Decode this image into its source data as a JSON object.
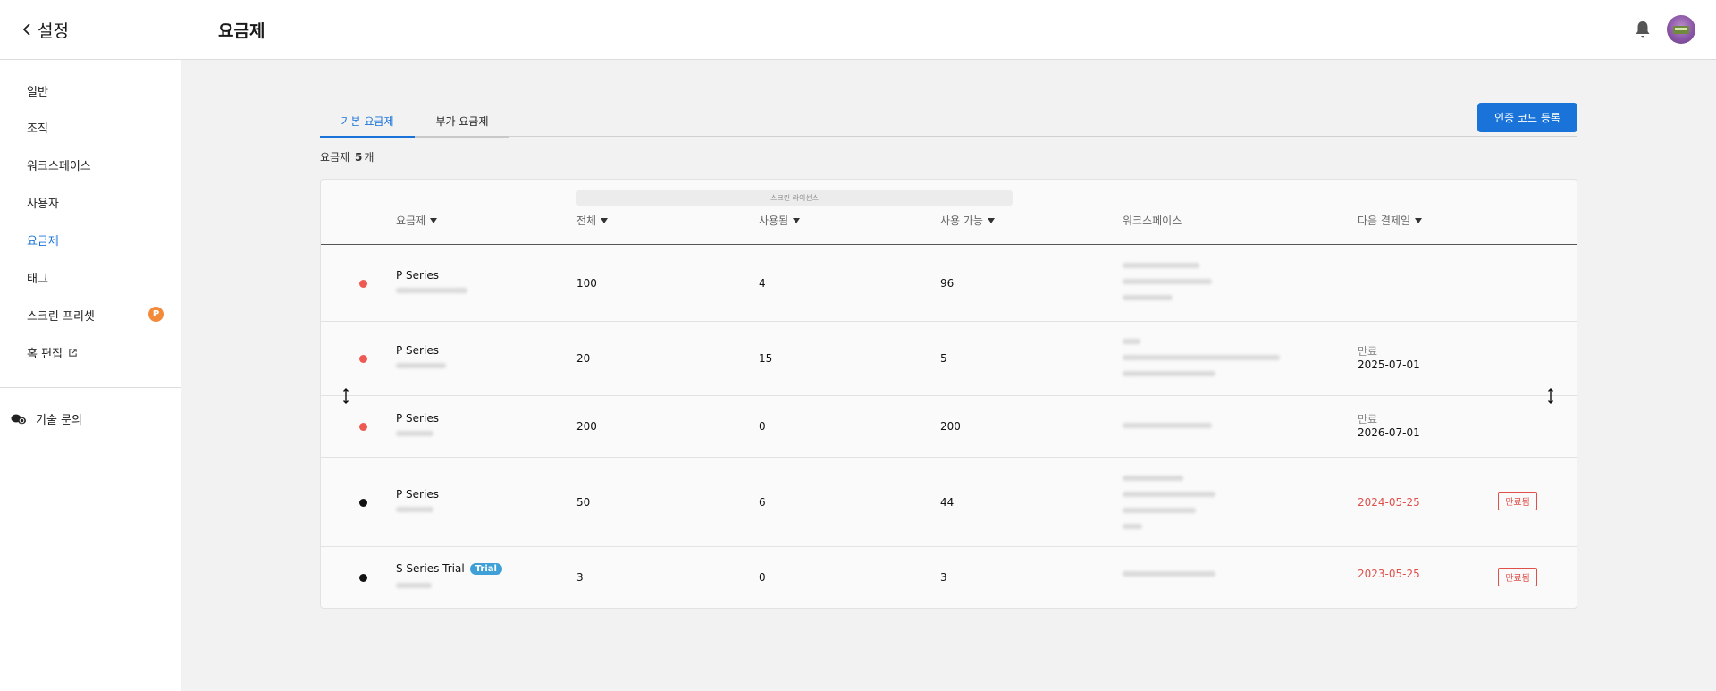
{
  "header": {
    "back_label": "설정",
    "title": "요금제"
  },
  "sidebar": {
    "items": [
      {
        "label": "일반"
      },
      {
        "label": "조직"
      },
      {
        "label": "워크스페이스"
      },
      {
        "label": "사용자"
      },
      {
        "label": "요금제"
      },
      {
        "label": "태그"
      },
      {
        "label": "스크린 프리셋",
        "badge": "P"
      },
      {
        "label": "홈 편집"
      }
    ],
    "support_label": "기술 문의"
  },
  "tabs": {
    "basic": "기본 요금제",
    "addon": "부가 요금제"
  },
  "cta_label": "인증 코드 등록",
  "count": {
    "prefix": "요금제",
    "value": "5",
    "suffix": "개"
  },
  "table": {
    "group_header": "스크린 라이선스",
    "columns": {
      "plan": "요금제",
      "total": "전체",
      "used": "사용됨",
      "available": "사용 가능",
      "workspace": "워크스페이스",
      "next_payment": "다음 결제일"
    },
    "rows": [
      {
        "status": "active",
        "plan": "P Series",
        "badge": "",
        "total": "100",
        "used": "4",
        "available": "96",
        "exp_label": "",
        "exp_date": "",
        "expired_tag": ""
      },
      {
        "status": "active",
        "plan": "P Series",
        "badge": "",
        "total": "20",
        "used": "15",
        "available": "5",
        "exp_label": "만료",
        "exp_date": "2025-07-01",
        "expired_tag": ""
      },
      {
        "status": "active",
        "plan": "P Series",
        "badge": "",
        "total": "200",
        "used": "0",
        "available": "200",
        "exp_label": "만료",
        "exp_date": "2026-07-01",
        "expired_tag": ""
      },
      {
        "status": "expired",
        "plan": "P Series",
        "badge": "",
        "total": "50",
        "used": "6",
        "available": "44",
        "exp_label": "",
        "exp_date": "2024-05-25",
        "expired_tag": "만료됨"
      },
      {
        "status": "expired",
        "plan": "S Series Trial",
        "badge": "Trial",
        "total": "3",
        "used": "0",
        "available": "3",
        "exp_label": "",
        "exp_date": "2023-05-25",
        "expired_tag": "만료됨"
      }
    ]
  },
  "colors": {
    "accent": "#1a73d9",
    "active_dot": "#ee5a52",
    "expired_text": "#e0504a",
    "badge_orange": "#f28a3c",
    "trial_badge": "#3fa0d8"
  }
}
